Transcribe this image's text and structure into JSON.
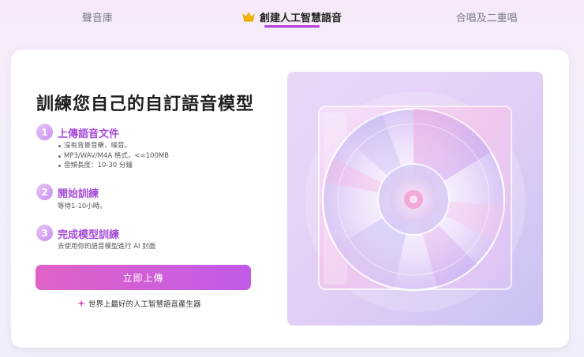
{
  "tabs": [
    {
      "label": "聲音庫",
      "active": false
    },
    {
      "label": "創建人工智慧語音",
      "active": true
    },
    {
      "label": "合唱及二重唱",
      "active": false
    }
  ],
  "main": {
    "title": "訓練您自己的自訂語音模型",
    "steps": [
      {
        "number": "1",
        "title": "上傳語音文件",
        "bullets": [
          "沒有背景音樂，噪音。",
          "MP3/WAV/M4A 格式，<=100MB",
          "音頻長度：10-30 分鐘"
        ]
      },
      {
        "number": "2",
        "title": "開始訓練",
        "desc": "等待1-10小時。"
      },
      {
        "number": "3",
        "title": "完成模型訓練",
        "desc": "去使用你的語音模型進行 AI 封面"
      }
    ],
    "upload_button": "立即上傳",
    "tagline": "世界上最好的人工智慧語音產生器"
  },
  "icons": {
    "active_tab": "crown-icon",
    "tagline": "sparkle-icon",
    "illustration": "cd-disc-illustration"
  },
  "colors": {
    "accent": "#b53fd9",
    "button_start": "#e062c6",
    "button_end": "#c15ae8",
    "step_title": "#a54cd7",
    "crown": "#f4b400"
  }
}
